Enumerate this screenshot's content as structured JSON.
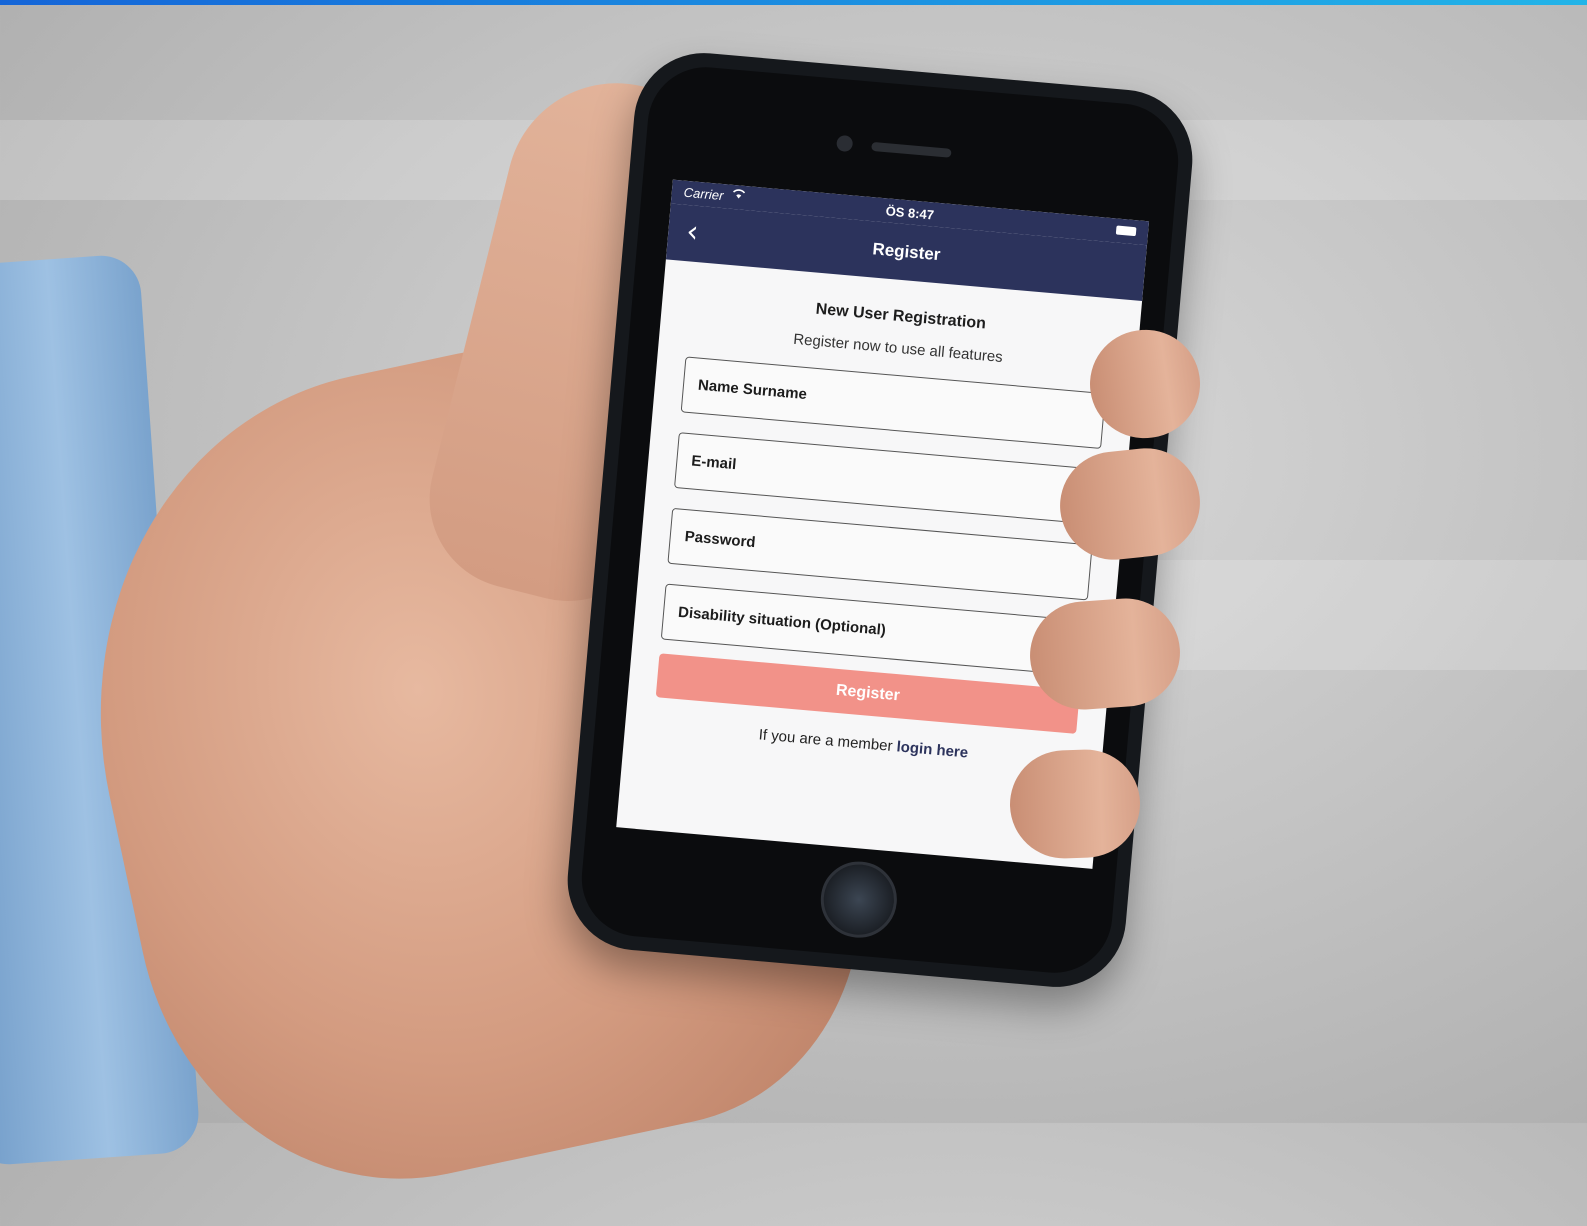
{
  "accent_colors": {
    "nav": "#2c335c",
    "register_button": "#f29289",
    "top_bar": "#1565d8"
  },
  "status_bar": {
    "carrier": "Carrier",
    "time": "ÖS 8:47",
    "wifi_icon": "wifi-icon",
    "battery_icon": "battery-icon"
  },
  "nav": {
    "back_icon": "‹",
    "title": "Register"
  },
  "form": {
    "title": "New User Registration",
    "subtitle": "Register now to use all features",
    "fields": {
      "name": "Name Surname",
      "email": "E-mail",
      "password": "Password",
      "disability": "Disability situation (Optional)"
    },
    "register_label": "Register",
    "login_prefix": "If you are a member",
    "login_link": "login here"
  }
}
